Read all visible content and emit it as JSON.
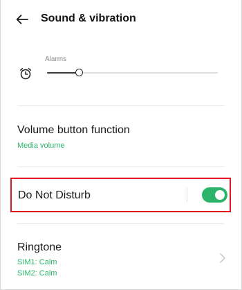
{
  "header": {
    "title": "Sound & vibration",
    "back_icon": "arrow-left-icon"
  },
  "alarms": {
    "label": "Alarms",
    "icon": "alarm-clock-icon",
    "level_fraction": 0.19
  },
  "volume_button": {
    "title": "Volume button function",
    "value": "Media volume"
  },
  "do_not_disturb": {
    "title": "Do Not Disturb",
    "enabled": true
  },
  "ringtone": {
    "title": "Ringtone",
    "sim1": "SIM1: Calm",
    "sim2": "SIM2: Calm",
    "icon": "chevron-right-icon"
  },
  "colors": {
    "accent_green": "#2cb56a",
    "highlight_red": "#e0161e"
  }
}
